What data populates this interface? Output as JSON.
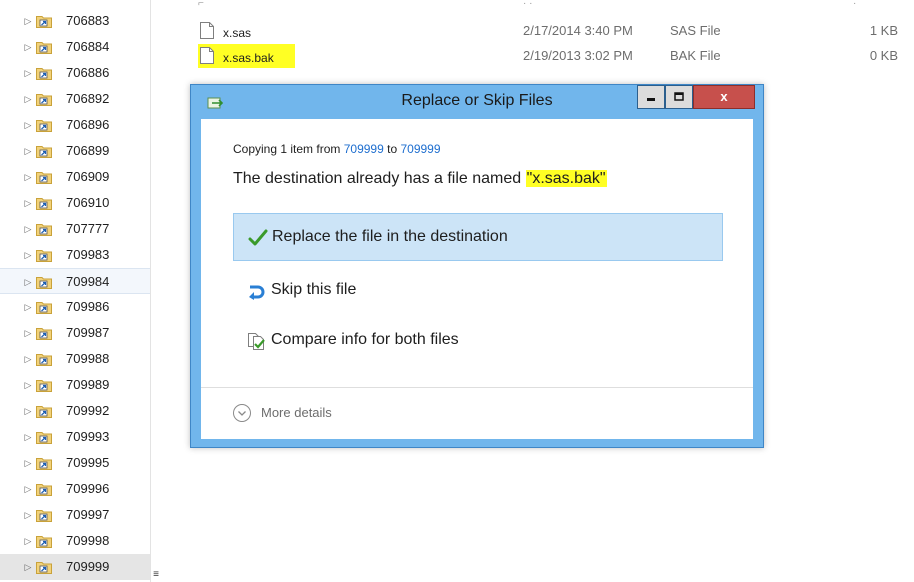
{
  "tree": {
    "items": [
      {
        "label": "706883"
      },
      {
        "label": "706884"
      },
      {
        "label": "706886"
      },
      {
        "label": "706892"
      },
      {
        "label": "706896"
      },
      {
        "label": "706899"
      },
      {
        "label": "706909"
      },
      {
        "label": "706910"
      },
      {
        "label": "707777"
      },
      {
        "label": "709983"
      },
      {
        "label": "709984",
        "state": "selected"
      },
      {
        "label": "709986"
      },
      {
        "label": "709987"
      },
      {
        "label": "709988"
      },
      {
        "label": "709989"
      },
      {
        "label": "709992"
      },
      {
        "label": "709993"
      },
      {
        "label": "709995"
      },
      {
        "label": "709996"
      },
      {
        "label": "709997"
      },
      {
        "label": "709998"
      },
      {
        "label": "709999",
        "state": "current"
      }
    ],
    "grip_glyph": "≡"
  },
  "files": [
    {
      "name": "x.sas",
      "date": "2/17/2014 3:40 PM",
      "type": "SAS File",
      "size": "1 KB",
      "highlighted": false
    },
    {
      "name": "x.sas.bak",
      "date": "2/19/2013 3:02 PM",
      "type": "BAK File",
      "size": "0 KB",
      "highlighted": true
    }
  ],
  "dialog": {
    "title": "Replace or Skip Files",
    "caption_buttons": {
      "minimize": "▁",
      "maximize": "☐",
      "close": "x"
    },
    "copy_prefix": "Copying 1 item from",
    "copy_from": "709999",
    "copy_mid": "to",
    "copy_to": "709999",
    "dest_prefix": "The destination already has a file named",
    "dest_filename": "\"x.sas.bak\"",
    "options": {
      "replace": "Replace the file in the destination",
      "skip": "Skip this file",
      "compare": "Compare info for both files"
    },
    "more_details": "More details"
  },
  "icons": {
    "tree_expander": "chevron-right-icon",
    "tree_folder": "folder-shortcut-icon",
    "file": "file-icon",
    "replace": "checkmark-icon",
    "skip": "skip-arrow-icon",
    "compare": "compare-files-icon",
    "more": "chevron-down-circle-icon"
  },
  "colors": {
    "dialog_frame": "#71b6ec",
    "selected_option": "#cce4f7",
    "highlight": "#ffff24",
    "link": "#1e6ecf",
    "close_button": "#c7504c"
  }
}
